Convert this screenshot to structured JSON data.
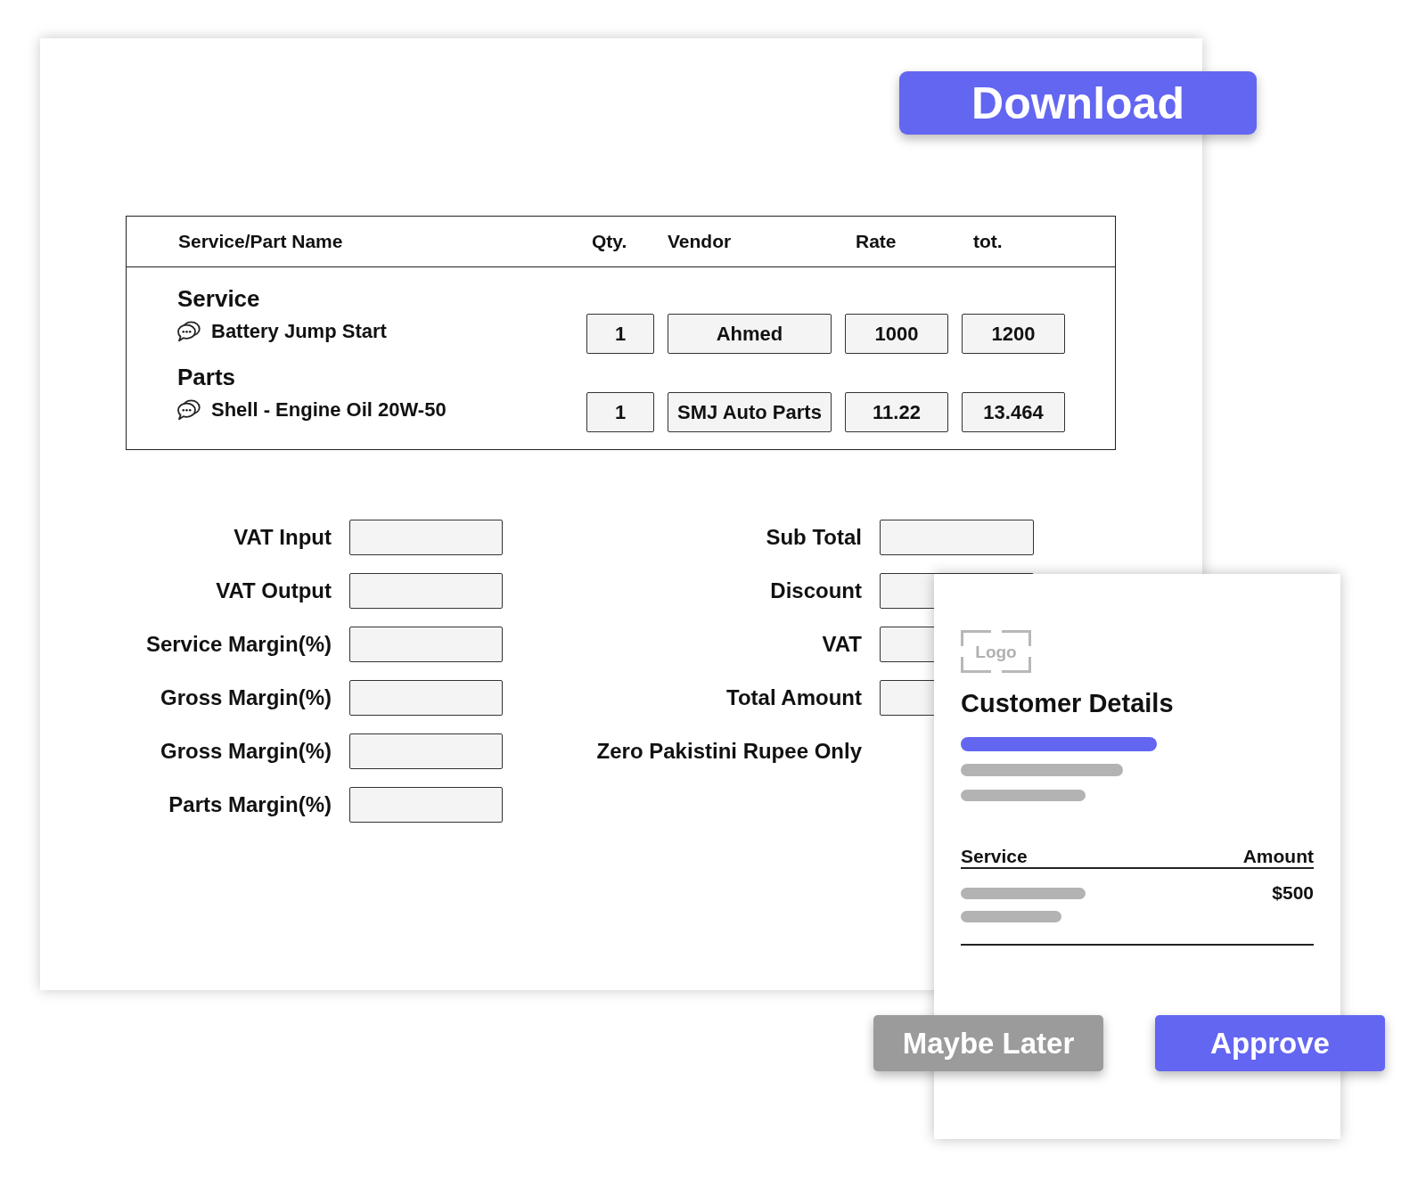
{
  "download_button": {
    "label": "Download"
  },
  "table": {
    "columns": [
      "Service/Part Name",
      "Qty.",
      "Vendor",
      "Rate",
      "tot."
    ],
    "sections": [
      {
        "title": "Service",
        "items": [
          {
            "name": "Battery Jump Start",
            "qty": "1",
            "vendor": "Ahmed",
            "rate": "1000",
            "total": "1200"
          }
        ]
      },
      {
        "title": "Parts",
        "items": [
          {
            "name": "Shell - Engine Oil 20W-50",
            "qty": "1",
            "vendor": "SMJ Auto Parts",
            "rate": "11.22",
            "total": "13.464"
          }
        ]
      }
    ]
  },
  "margins_form": {
    "fields": [
      {
        "label": "VAT Input"
      },
      {
        "label": "VAT Output"
      },
      {
        "label": "Service Margin(%)"
      },
      {
        "label": "Gross Margin(%)"
      },
      {
        "label": "Gross Margin(%)"
      },
      {
        "label": "Parts Margin(%)"
      }
    ]
  },
  "totals_form": {
    "fields": [
      {
        "label": "Sub Total"
      },
      {
        "label": "Discount"
      },
      {
        "label": "VAT"
      },
      {
        "label": "Total Amount"
      }
    ],
    "amount_in_words": "Zero Pakistini Rupee Only"
  },
  "customer_card": {
    "logo": "Logo",
    "title": "Customer Details",
    "table": {
      "columns": [
        "Service",
        "Amount"
      ],
      "rows": [
        {
          "amount": "$500"
        }
      ]
    }
  },
  "actions": [
    {
      "label": "Maybe Later",
      "kind": "secondary"
    },
    {
      "label": "Approve",
      "kind": "primary"
    }
  ]
}
